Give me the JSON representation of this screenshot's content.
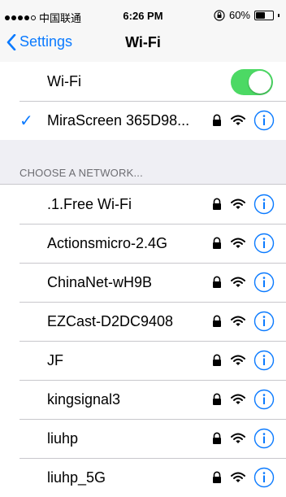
{
  "status": {
    "carrier": "中国联通",
    "time": "6:26 PM",
    "battery": "60%",
    "battery_level": 0.6
  },
  "nav": {
    "back_label": "Settings",
    "title": "Wi-Fi"
  },
  "wifi_toggle": {
    "label": "Wi-Fi",
    "on": true
  },
  "connected": {
    "name": "MiraScreen 365D98..."
  },
  "choose_header": "CHOOSE A NETWORK...",
  "networks": [
    {
      "name": ".1.Free Wi-Fi"
    },
    {
      "name": "Actionsmicro-2.4G"
    },
    {
      "name": "ChinaNet-wH9B"
    },
    {
      "name": "EZCast-D2DC9408"
    },
    {
      "name": "JF"
    },
    {
      "name": "kingsignal3"
    },
    {
      "name": "liuhp"
    },
    {
      "name": "liuhp_5G"
    }
  ],
  "colors": {
    "accent": "#0a7aff",
    "toggle_on": "#4cd964"
  }
}
